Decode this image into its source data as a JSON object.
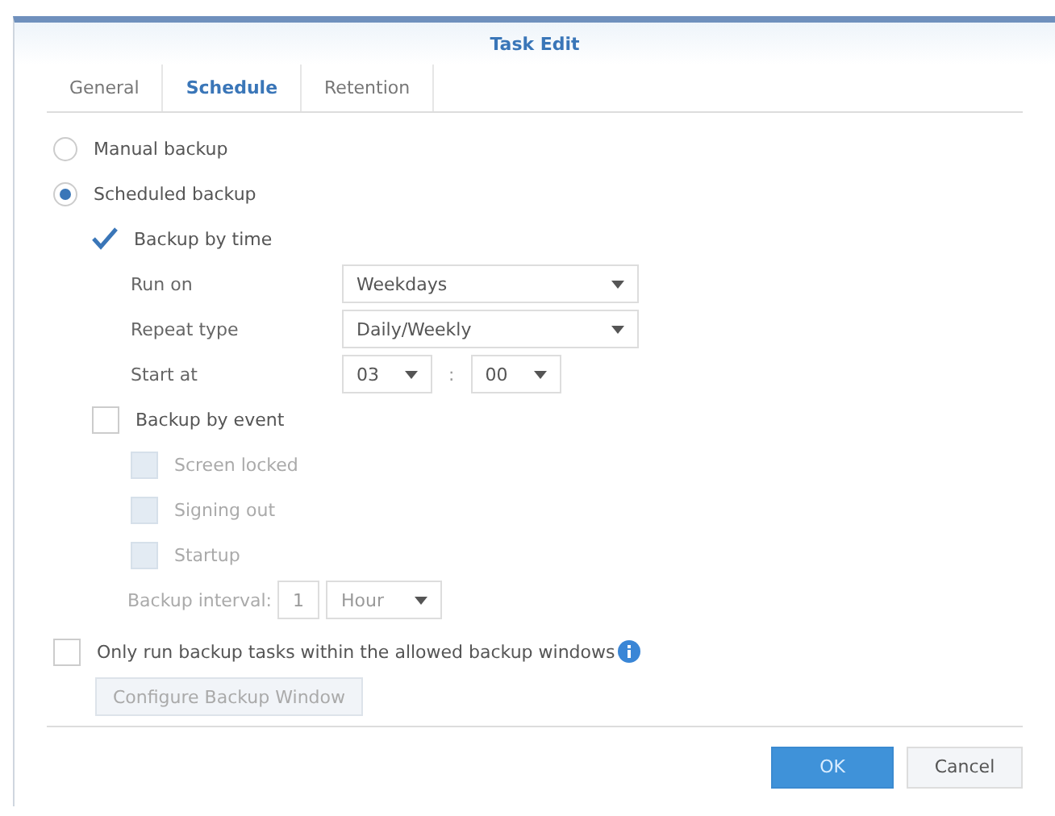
{
  "window": {
    "title": "Task Edit"
  },
  "tabs": [
    {
      "label": "General",
      "selected": false
    },
    {
      "label": "Schedule",
      "selected": true
    },
    {
      "label": "Retention",
      "selected": false
    }
  ],
  "modes": [
    {
      "label": "Manual backup",
      "selected": false
    },
    {
      "label": "Scheduled backup",
      "selected": true
    }
  ],
  "time_backup": {
    "label": "Backup by time",
    "checked": true,
    "run_on": {
      "label": "Run on",
      "value": "Weekdays"
    },
    "repeat_type": {
      "label": "Repeat type",
      "value": "Daily/Weekly"
    },
    "start_at": {
      "label": "Start at",
      "hour": "03",
      "separator": ":",
      "minute": "00"
    }
  },
  "event_backup": {
    "label": "Backup by event",
    "checked": false,
    "events": [
      {
        "label": "Screen locked",
        "checked": false,
        "disabled": true
      },
      {
        "label": "Signing out",
        "checked": false,
        "disabled": true
      },
      {
        "label": "Startup",
        "checked": false,
        "disabled": true
      }
    ],
    "interval": {
      "label": "Backup interval:",
      "value": "1",
      "unit": "Hour",
      "disabled": true
    }
  },
  "window_limit": {
    "label": "Only run backup tasks within the allowed backup windows",
    "checked": false
  },
  "configure_button": {
    "label": "Configure Backup Window",
    "disabled": true
  },
  "buttons": [
    {
      "label": "OK",
      "kind": "primary"
    },
    {
      "label": "Cancel",
      "kind": "secondary"
    }
  ]
}
